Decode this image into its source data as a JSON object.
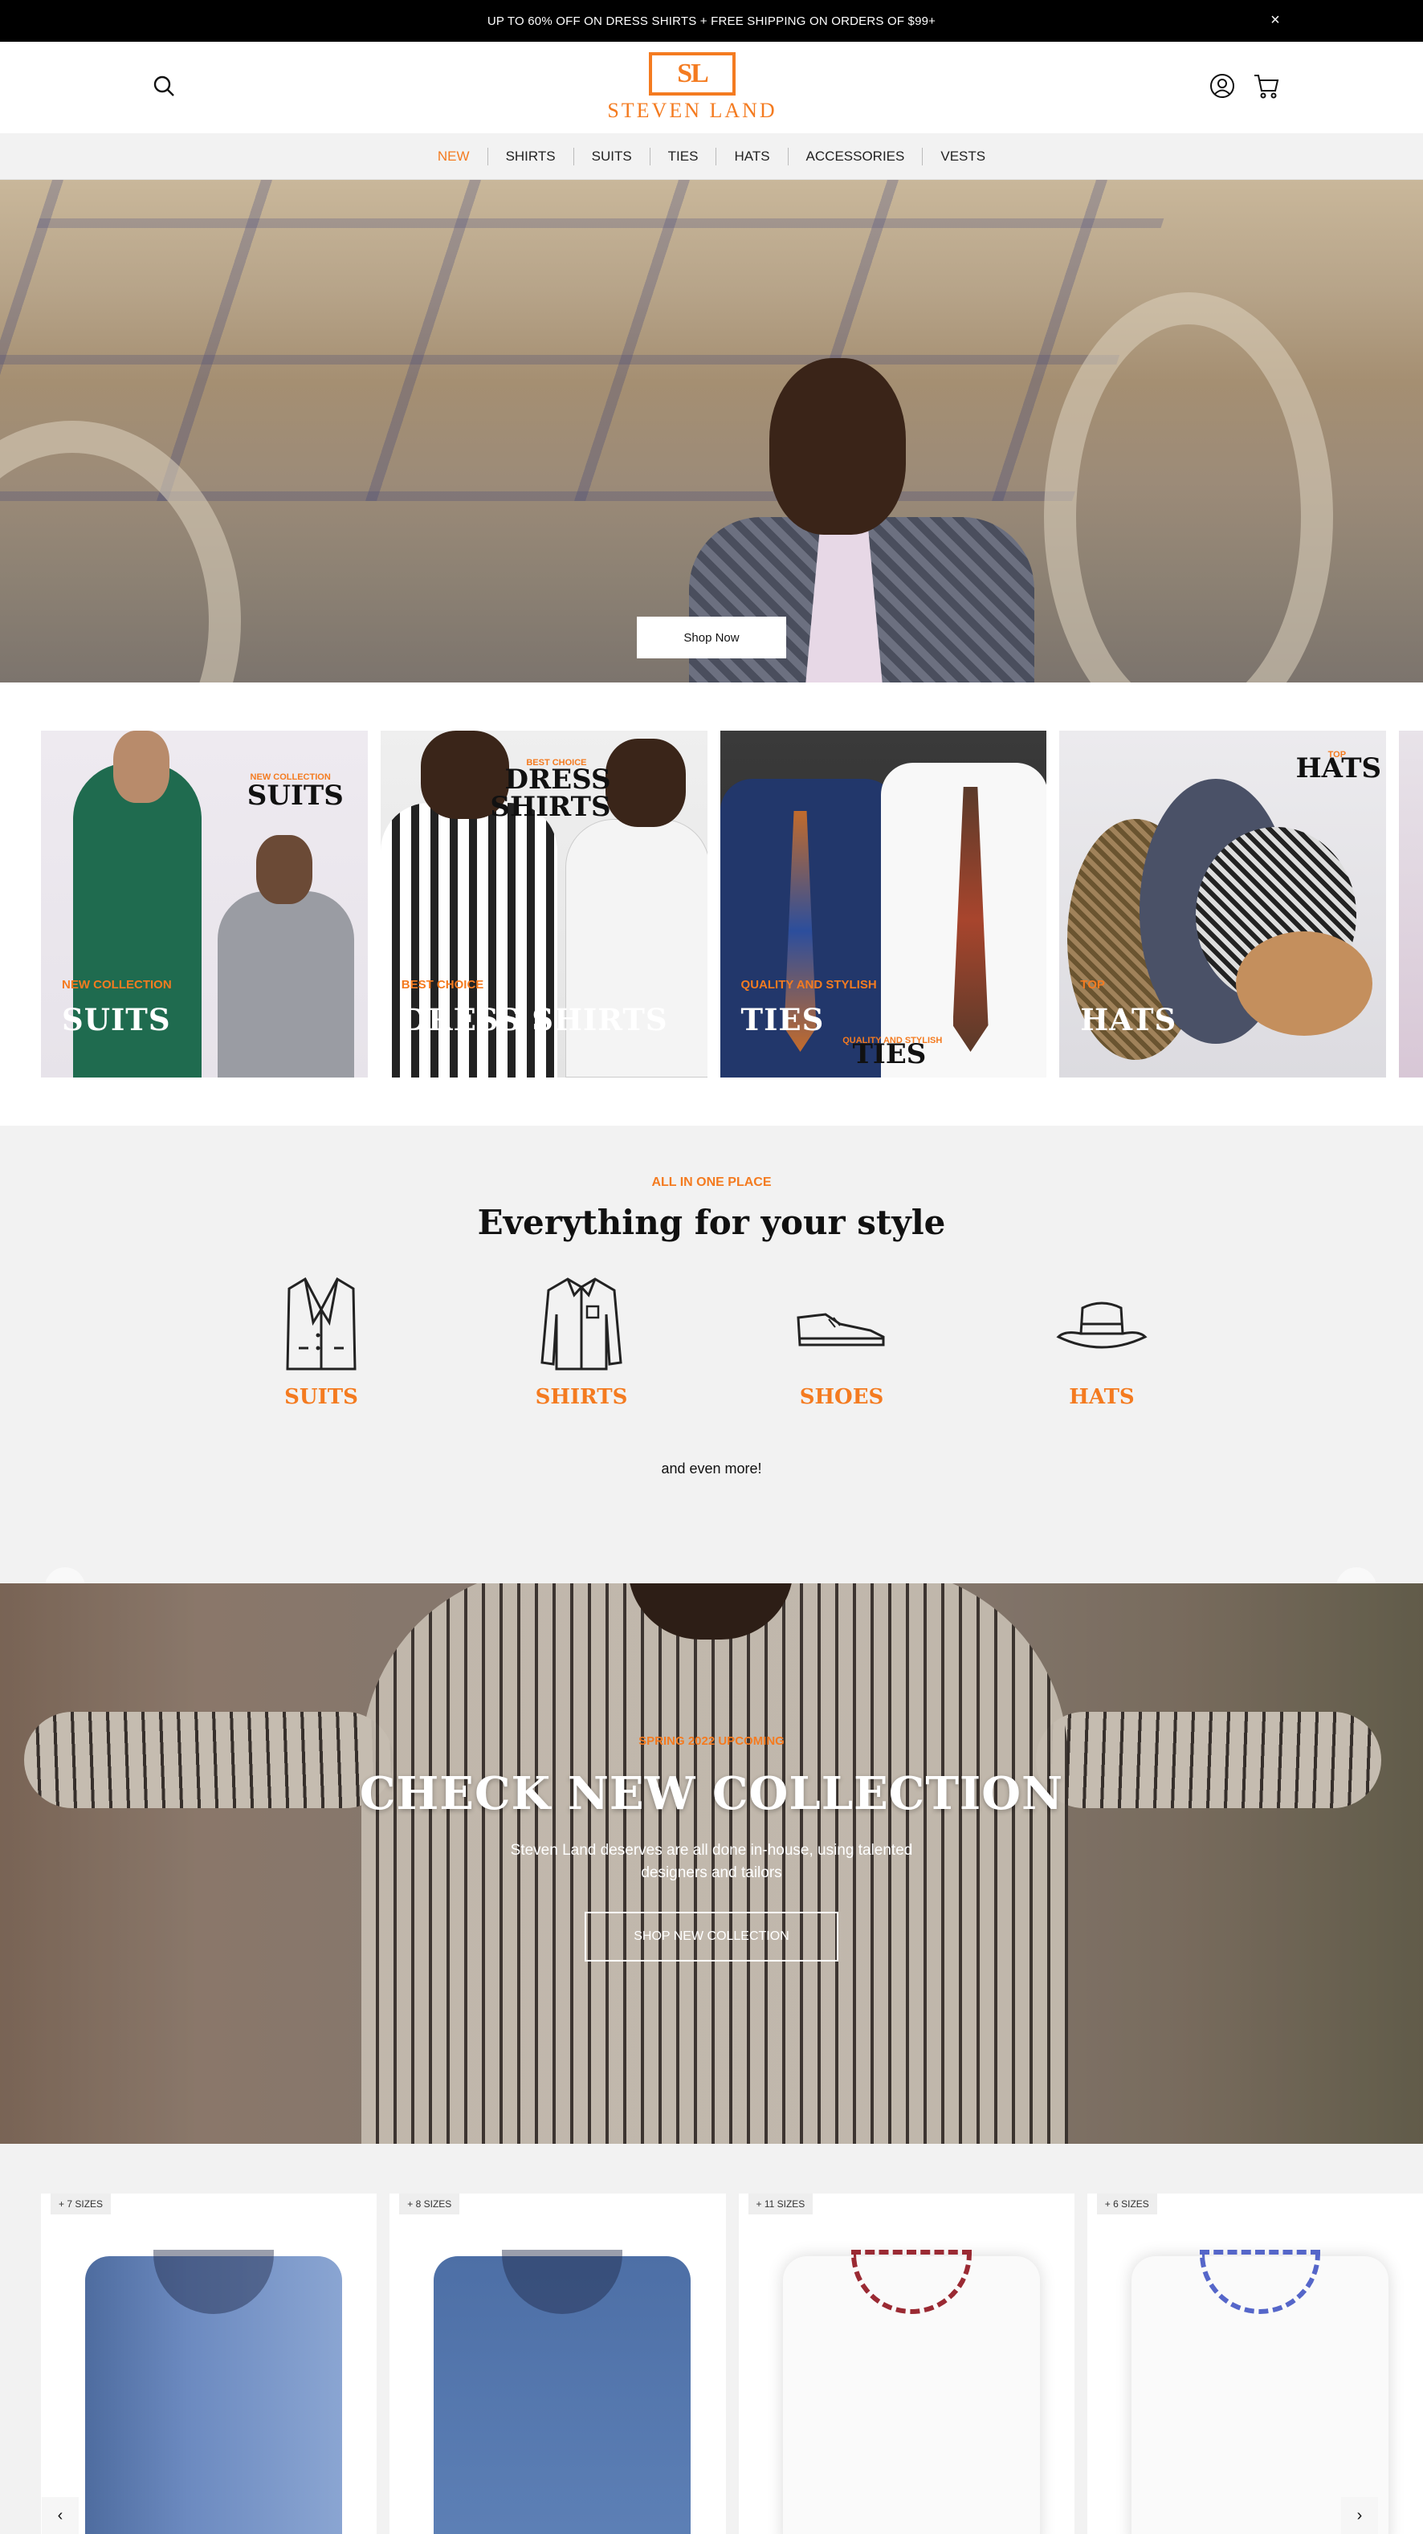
{
  "announcement": {
    "text": "UP TO 60% OFF ON DRESS SHIRTS + FREE SHIPPING ON ORDERS OF $99+",
    "close": "×"
  },
  "header": {
    "logo_mark": "SL",
    "logo_word": "STEVEN LAND"
  },
  "nav": [
    "NEW",
    "SHIRTS",
    "SUITS",
    "TIES",
    "HATS",
    "ACCESSORIES",
    "VESTS"
  ],
  "hero": {
    "button": "Shop Now"
  },
  "categories": [
    {
      "small": "NEW COLLECTION",
      "big": "SUITS",
      "corner_small": "NEW COLLECTION",
      "corner_big": "SUITS"
    },
    {
      "small": "BEST CHOICE",
      "big": "DRESS SHIRTS",
      "corner_small": "BEST CHOICE",
      "corner_big": "DRESS\nSHIRTS"
    },
    {
      "small": "QUALITY AND STYLISH",
      "big": "TIES",
      "corner_small": "QUALITY AND STYLISH",
      "corner_big": "TIES"
    },
    {
      "small": "TOP",
      "big": "HATS",
      "corner_small": "TOP",
      "corner_big": "HATS"
    }
  ],
  "style_section": {
    "eyebrow": "ALL IN ONE PLACE",
    "title": "Everything for your style",
    "items": [
      "SUITS",
      "SHIRTS",
      "SHOES",
      "HATS"
    ],
    "more": "and even more!"
  },
  "banner": {
    "eyebrow": "SPRING 2022 UPCOMING",
    "title": "CHECK NEW COLLECTION",
    "text": "Steven Land deserves are all done in-house, using talented designers and tailors",
    "button": "SHOP NEW COLLECTION"
  },
  "products": [
    {
      "sizes": "+ 7 SIZES"
    },
    {
      "sizes": "+ 8 SIZES"
    },
    {
      "sizes": "+ 11 SIZES"
    },
    {
      "sizes": "+ 6 SIZES"
    }
  ],
  "colors": {
    "accent": "#f47b20",
    "topbar": "#000000"
  }
}
